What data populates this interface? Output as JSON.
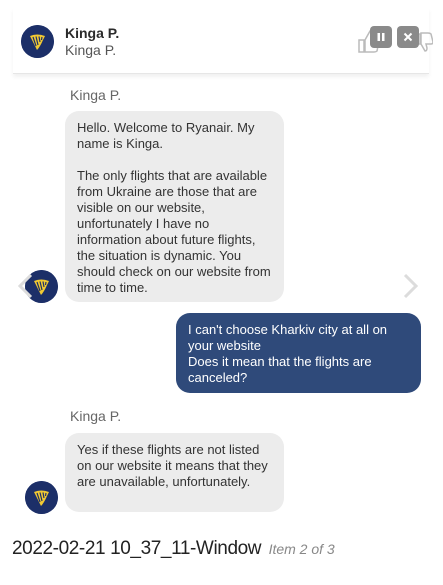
{
  "header": {
    "agent_name": "Kinga P.",
    "agent_subtitle": "Kinga P.",
    "pause_icon": "pause-icon",
    "close_icon": "close-icon",
    "thumbs_icon": "thumbs-up-icon"
  },
  "messages": [
    {
      "from": "agent",
      "sender": "Kinga P.",
      "text": "Hello. Welcome to Ryanair. My name is Kinga.\n\nThe only flights that are available from Ukraine are those that are visible on our website, unfortunately I have no information about future flights, the situation is dynamic. You should check on our website from time to time."
    },
    {
      "from": "user",
      "text": "I can't choose Kharkiv city at all on your website\nDoes it mean that the flights are canceled?"
    },
    {
      "from": "agent",
      "sender": "Kinga P.",
      "text": "Yes if these flights are not listed on our website it means that they are unavailable, unfortunately."
    }
  ],
  "caption": {
    "filename": "2022-02-21 10_37_11-Window",
    "item": "Item 2 of 3"
  },
  "colors": {
    "brand_navy": "#1c2f68",
    "user_bubble": "#2f4a7a",
    "agent_bubble": "#ececec",
    "logo_gold": "#f1c933"
  }
}
